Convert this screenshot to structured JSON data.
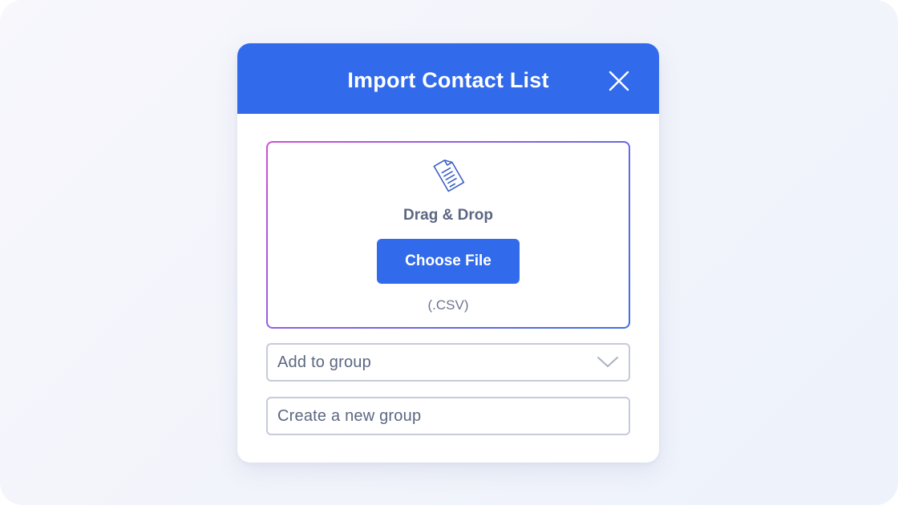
{
  "dialog": {
    "title": "Import Contact List",
    "close_icon": "close-icon"
  },
  "dropzone": {
    "icon": "document-icon",
    "drag_text": "Drag & Drop",
    "choose_label": "Choose File",
    "format_hint": "(.CSV)"
  },
  "group_select": {
    "value": "Add to group",
    "icon": "chevron-down-icon"
  },
  "new_group_input": {
    "placeholder": "Create a new group"
  },
  "colors": {
    "accent": "#316aea",
    "dropzone_gradient_start": "#d04fd4",
    "dropzone_gradient_end": "#3f6fe6",
    "text_muted": "#5b6782",
    "border": "#c6cbdb"
  }
}
